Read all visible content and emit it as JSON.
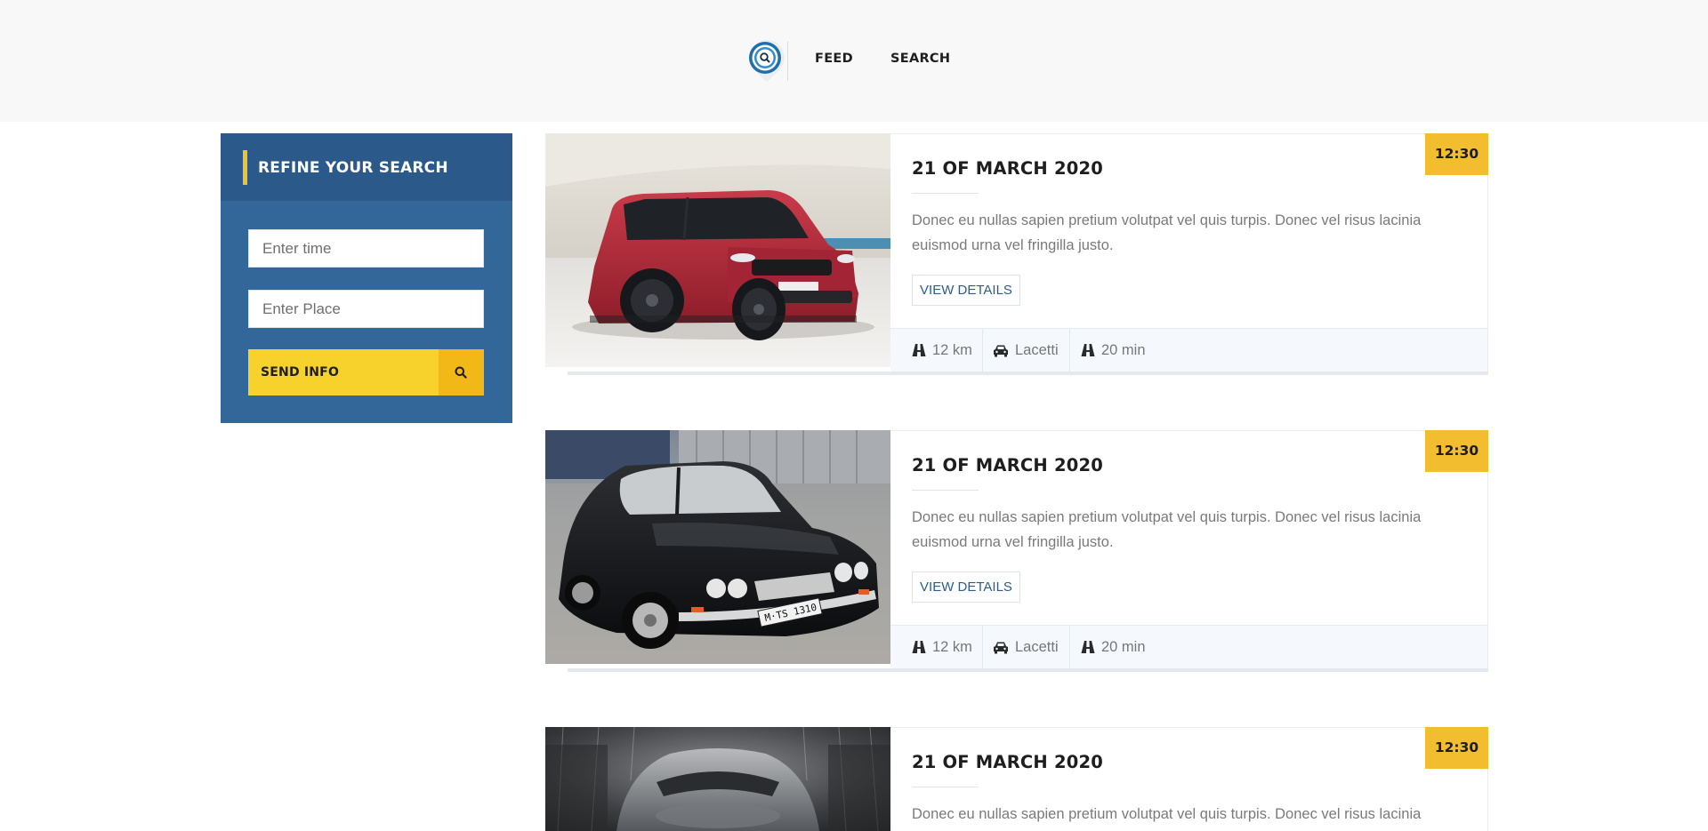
{
  "header": {
    "logo_icon": "location-pin-search-icon",
    "nav": [
      {
        "label": "FEED"
      },
      {
        "label": "SEARCH"
      }
    ]
  },
  "sidebar": {
    "title": "REFINE YOUR SEARCH",
    "time_placeholder": "Enter time",
    "place_placeholder": "Enter Place",
    "send_label": "SEND INFO",
    "send_icon": "search-icon"
  },
  "colors": {
    "sidebar_bg": "#336699",
    "accent_yellow": "#f7d12c",
    "badge_yellow": "#f3bd30",
    "link_blue": "#2c5d8e"
  },
  "cards": [
    {
      "image": "red-suv-photo",
      "date": "21 OF MARCH 2020",
      "time": "12:30",
      "description": "Donec eu nullas sapien pretium volutpat vel quis turpis. Donec vel risus lacinia euismod urna vel fringilla justo.",
      "details_label": "VIEW DETAILS",
      "distance": "12 km",
      "car": "Lacetti",
      "duration": "20 min"
    },
    {
      "image": "black-classic-coupe-photo",
      "date": "21 OF MARCH 2020",
      "time": "12:30",
      "description": "Donec eu nullas sapien pretium volutpat vel quis turpis. Donec vel risus lacinia euismod urna vel fringilla justo.",
      "details_label": "VIEW DETAILS",
      "distance": "12 km",
      "car": "Lacetti",
      "duration": "20 min"
    },
    {
      "image": "silver-sports-car-photo",
      "date": "21 OF MARCH 2020",
      "time": "12:30",
      "description": "Donec eu nullas sapien pretium volutpat vel quis turpis. Donec vel risus lacinia"
    }
  ]
}
